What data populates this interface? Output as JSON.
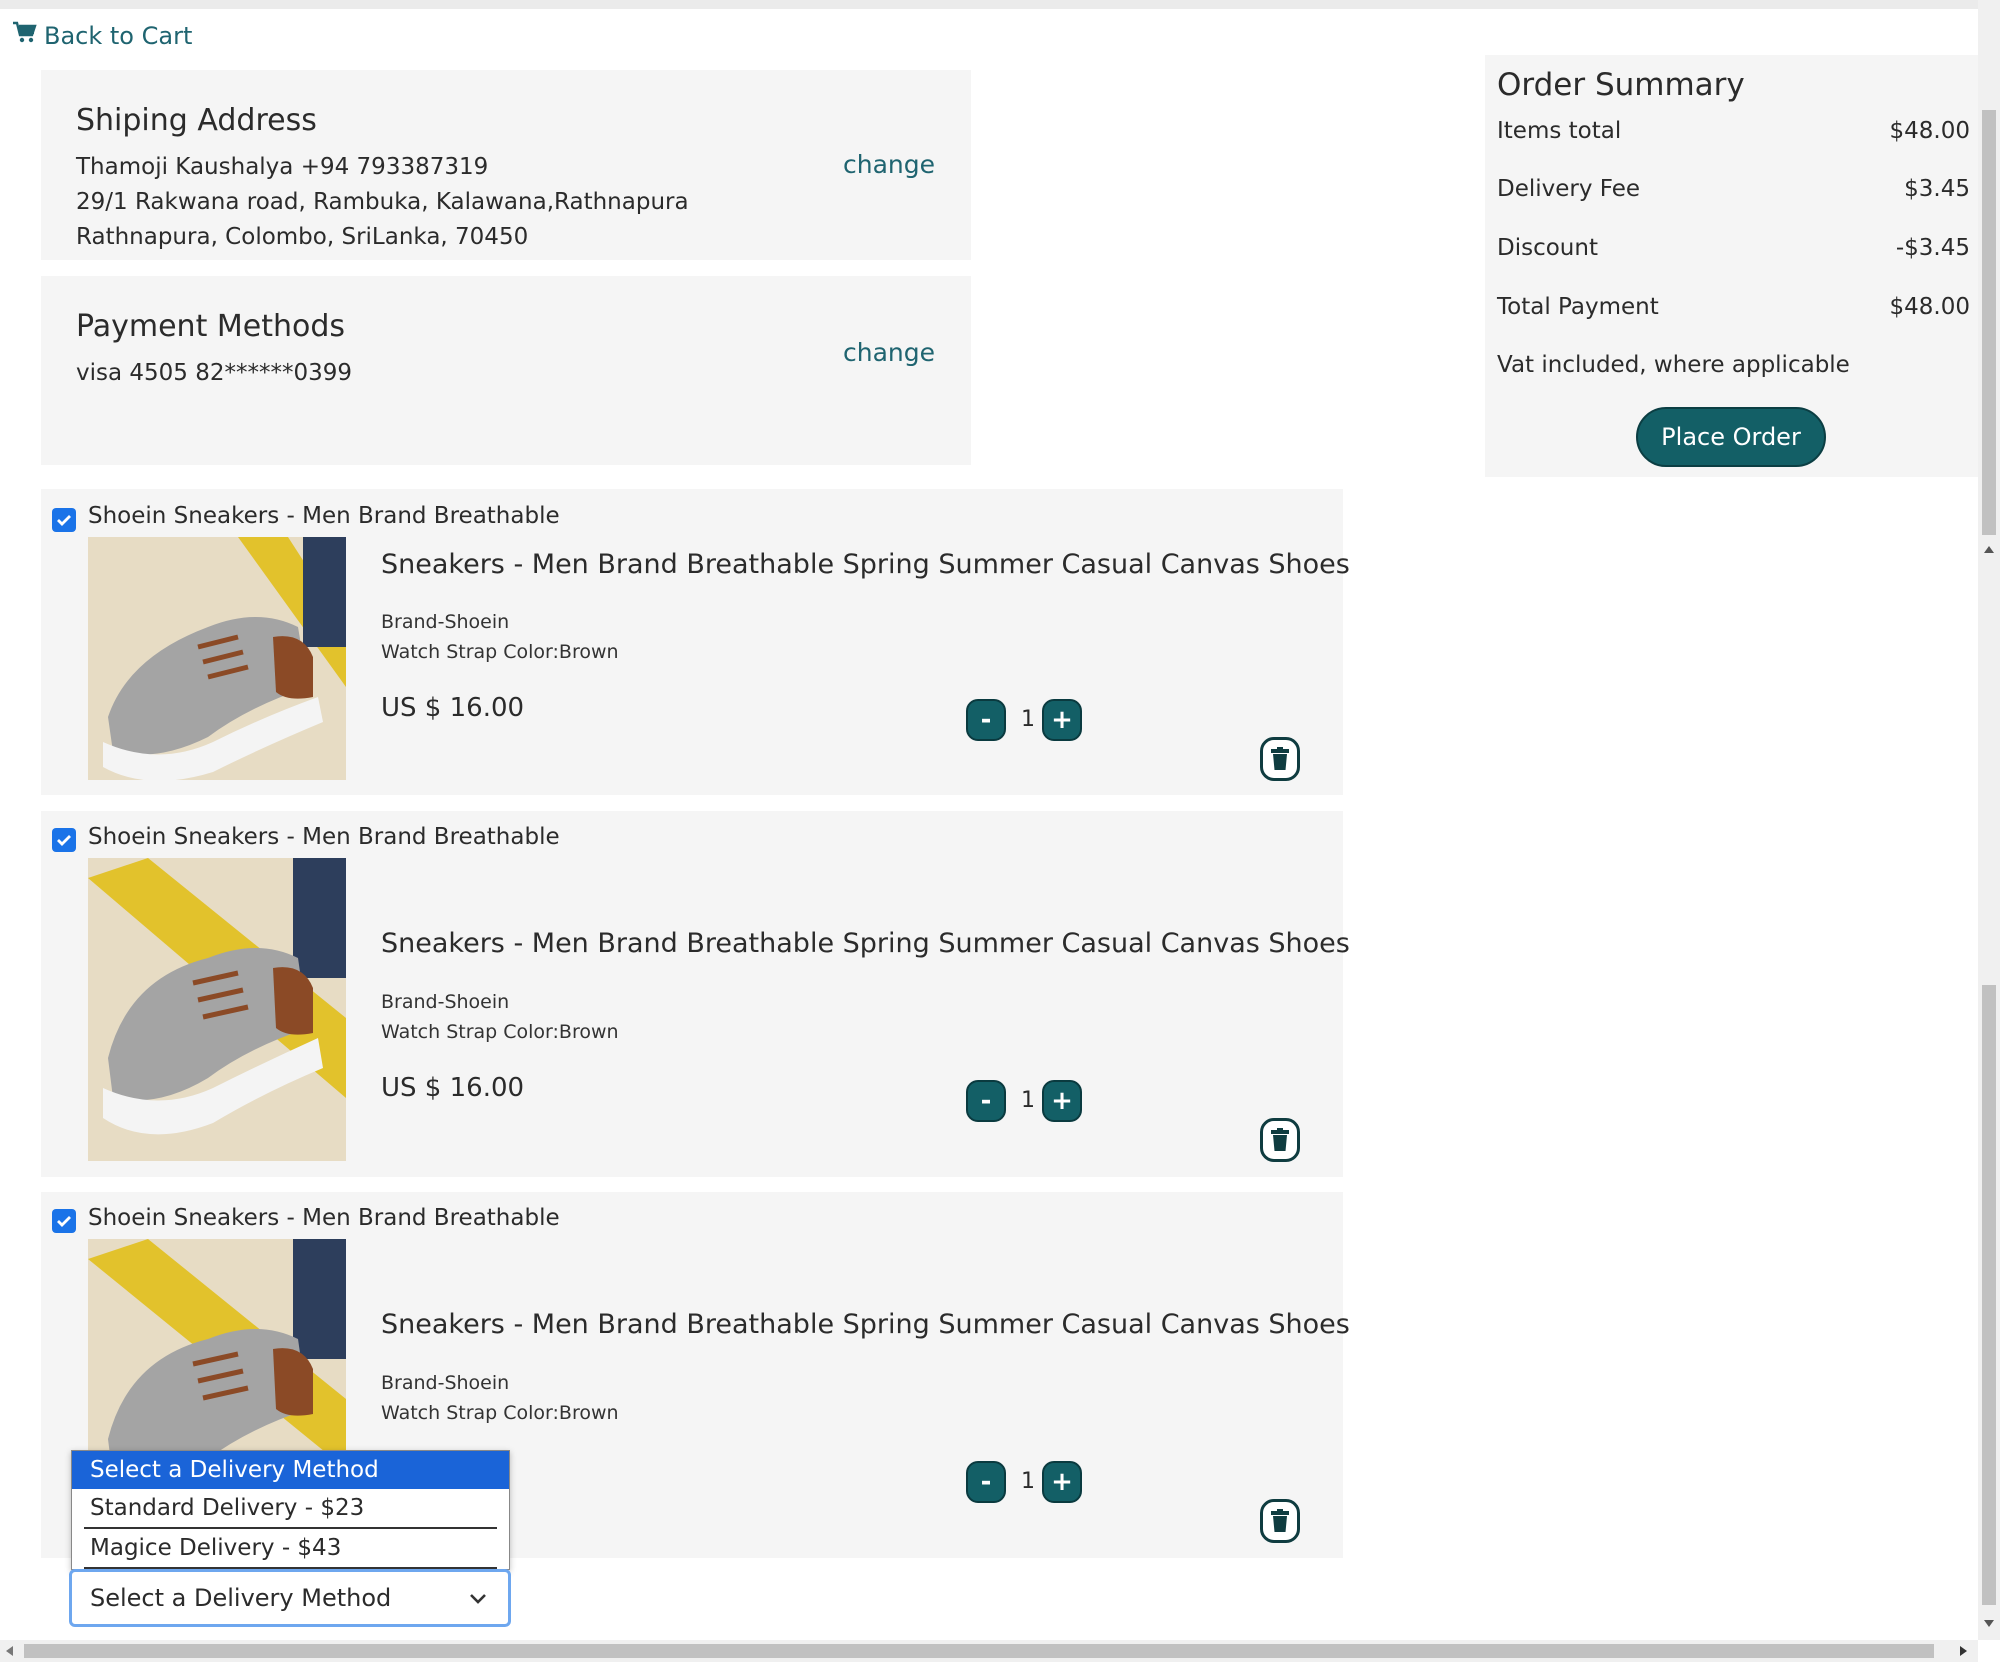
{
  "nav": {
    "back_label": "Back to Cart"
  },
  "shipping": {
    "title": "Shiping Address",
    "name_line": "Thamoji Kaushalya +94 793387319",
    "address_line1": "29/1 Rakwana road, Rambuka, Kalawana,Rathnapura",
    "address_line2": "Rathnapura, Colombo, SriLanka, 70450",
    "change_label": "change"
  },
  "payment": {
    "title": "Payment Methods",
    "card_line": "visa 4505 82******0399",
    "change_label": "change"
  },
  "summary": {
    "title": "Order Summary",
    "items_total_label": "Items total",
    "items_total_value": "$48.00",
    "delivery_fee_label": "Delivery Fee",
    "delivery_fee_value": "$3.45",
    "discount_label": "Discount",
    "discount_value": "-$3.45",
    "total_label": "Total Payment",
    "total_value": "$48.00",
    "vat_note": "Vat included, where applicable",
    "place_order_label": "Place Order"
  },
  "items": [
    {
      "shop": "Shoein Sneakers - Men Brand Breathable",
      "name": "Sneakers - Men Brand Breathable Spring Summer Casual Canvas Shoes",
      "brand": "Brand-Shoein",
      "color": "Watch Strap Color:Brown",
      "price": "US $ 16.00",
      "qty": "1",
      "minus": "-",
      "plus": "+"
    },
    {
      "shop": "Shoein Sneakers - Men Brand Breathable",
      "name": "Sneakers - Men Brand Breathable Spring Summer Casual Canvas Shoes",
      "brand": "Brand-Shoein",
      "color": "Watch Strap Color:Brown",
      "price": "US $ 16.00",
      "qty": "1",
      "minus": "-",
      "plus": "+"
    },
    {
      "shop": "Shoein Sneakers - Men Brand Breathable",
      "name": "Sneakers - Men Brand Breathable Spring Summer Casual Canvas Shoes",
      "brand": "Brand-Shoein",
      "color": "Watch Strap Color:Brown",
      "qty": "1",
      "minus": "-",
      "plus": "+"
    }
  ],
  "delivery": {
    "selected": "Select a Delivery Method",
    "options": [
      "Select a Delivery Method",
      "Standard Delivery - $23",
      "Magice Delivery - $43"
    ]
  },
  "icons": {
    "back": "cart-icon",
    "checkbox": "checkmark-icon",
    "trash": "trash-icon",
    "select": "chevron-down-icon"
  },
  "colors": {
    "accent": "#135f66",
    "link": "#1f6470",
    "checkbox": "#1a73e8",
    "card_bg": "#f5f5f5",
    "dropdown_highlight": "#1a64d8"
  }
}
